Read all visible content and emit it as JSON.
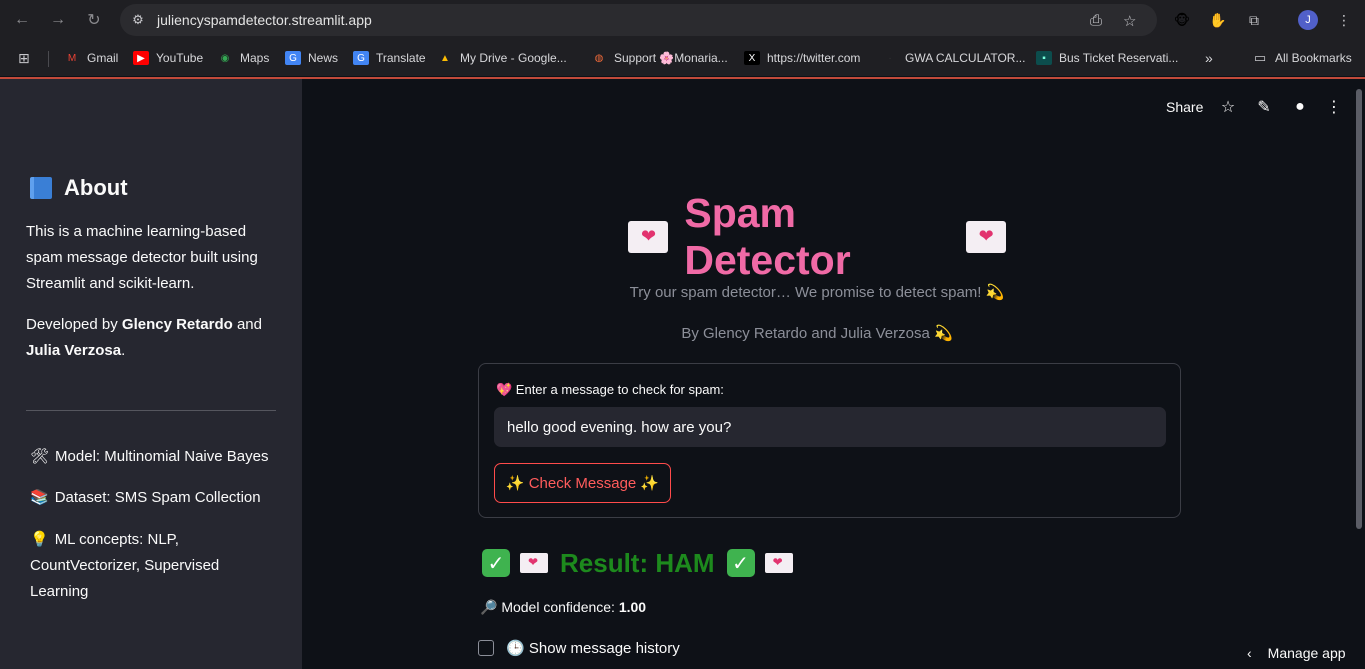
{
  "browser": {
    "url": "juliencyspamdetector.streamlit.app",
    "avatar_letter": "J",
    "bookmarks": [
      {
        "label": "Gmail",
        "icon": "gmail-icon"
      },
      {
        "label": "YouTube",
        "icon": "youtube-icon"
      },
      {
        "label": "Maps",
        "icon": "maps-icon"
      },
      {
        "label": "News",
        "icon": "news-icon"
      },
      {
        "label": "Translate",
        "icon": "translate-icon"
      },
      {
        "label": "My Drive - Google...",
        "icon": "drive-icon"
      },
      {
        "label": "Support 🌸Monaria...",
        "icon": "support-icon"
      },
      {
        "label": "https://twitter.com",
        "icon": "x-icon"
      },
      {
        "label": "GWA CALCULATOR...",
        "icon": "gwa-icon"
      },
      {
        "label": "Bus Ticket Reservati...",
        "icon": "bus-icon"
      }
    ],
    "more_bookmarks": "»",
    "all_bookmarks": "All Bookmarks"
  },
  "sidebar": {
    "heading": "About",
    "description": "This is a machine learning-based spam message detector built using Streamlit and scikit-learn.",
    "developed_prefix": "Developed by ",
    "developer1": "Glency Retardo",
    "developed_and": " and ",
    "developer2": "Julia Verzosa",
    "developed_suffix": ".",
    "model": "Model: Multinomial Naive Bayes",
    "dataset": "Dataset: SMS Spam Collection",
    "concepts": "ML concepts: NLP, CountVectorizer, Supervised Learning"
  },
  "toolbar": {
    "share": "Share"
  },
  "main": {
    "title": "Spam Detector",
    "subtitle": "Try our spam detector… We promise to detect spam! 💫",
    "byline": "By Glency Retardo and Julia Verzosa 💫",
    "input_label": "💖 Enter a message to check for spam:",
    "input_value": "hello good evening. how are you?",
    "check_button": "✨ Check Message ✨",
    "result": "Result: HAM",
    "confidence_label": "🔎 Model confidence: ",
    "confidence_value": "1.00",
    "history_label": "🕒 Show message history",
    "manage_app": "Manage app"
  },
  "colors": {
    "accent": "#f06aa6",
    "result_green": "#1d8a1d",
    "button_red": "#ff4b4b"
  }
}
